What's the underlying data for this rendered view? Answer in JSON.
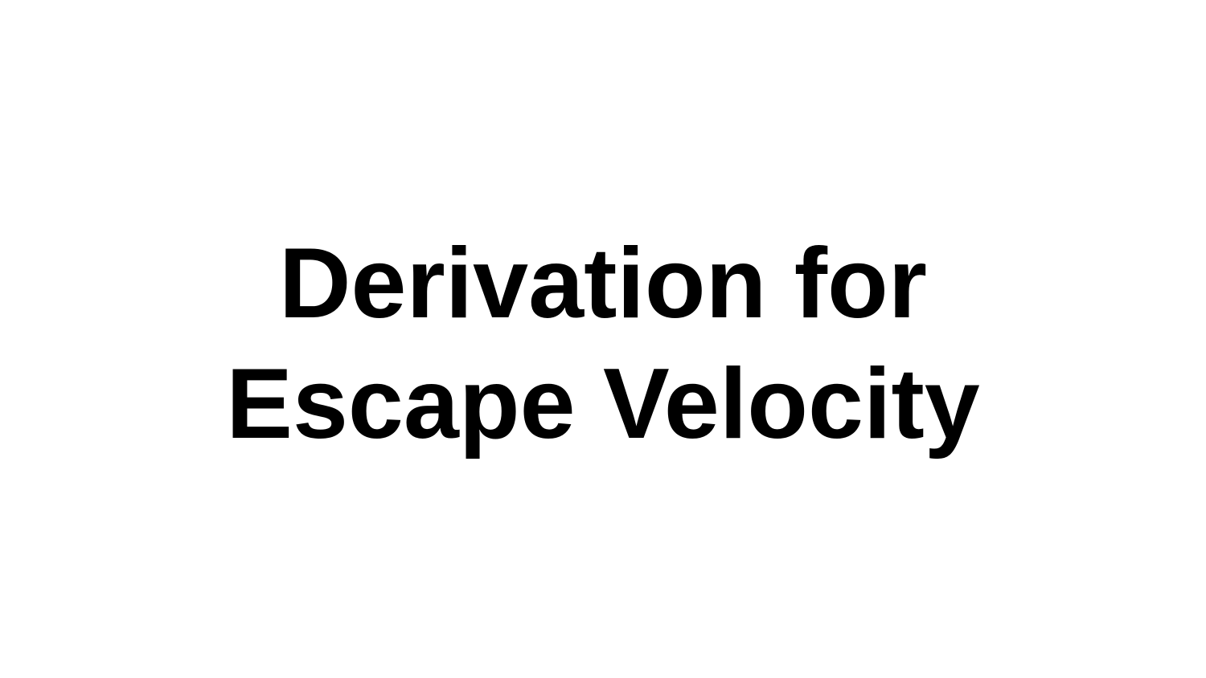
{
  "slide": {
    "title_lines": [
      "Derivation for",
      "Escape Velocity"
    ],
    "background_color": "#ffffff",
    "text_color": "#000000"
  }
}
